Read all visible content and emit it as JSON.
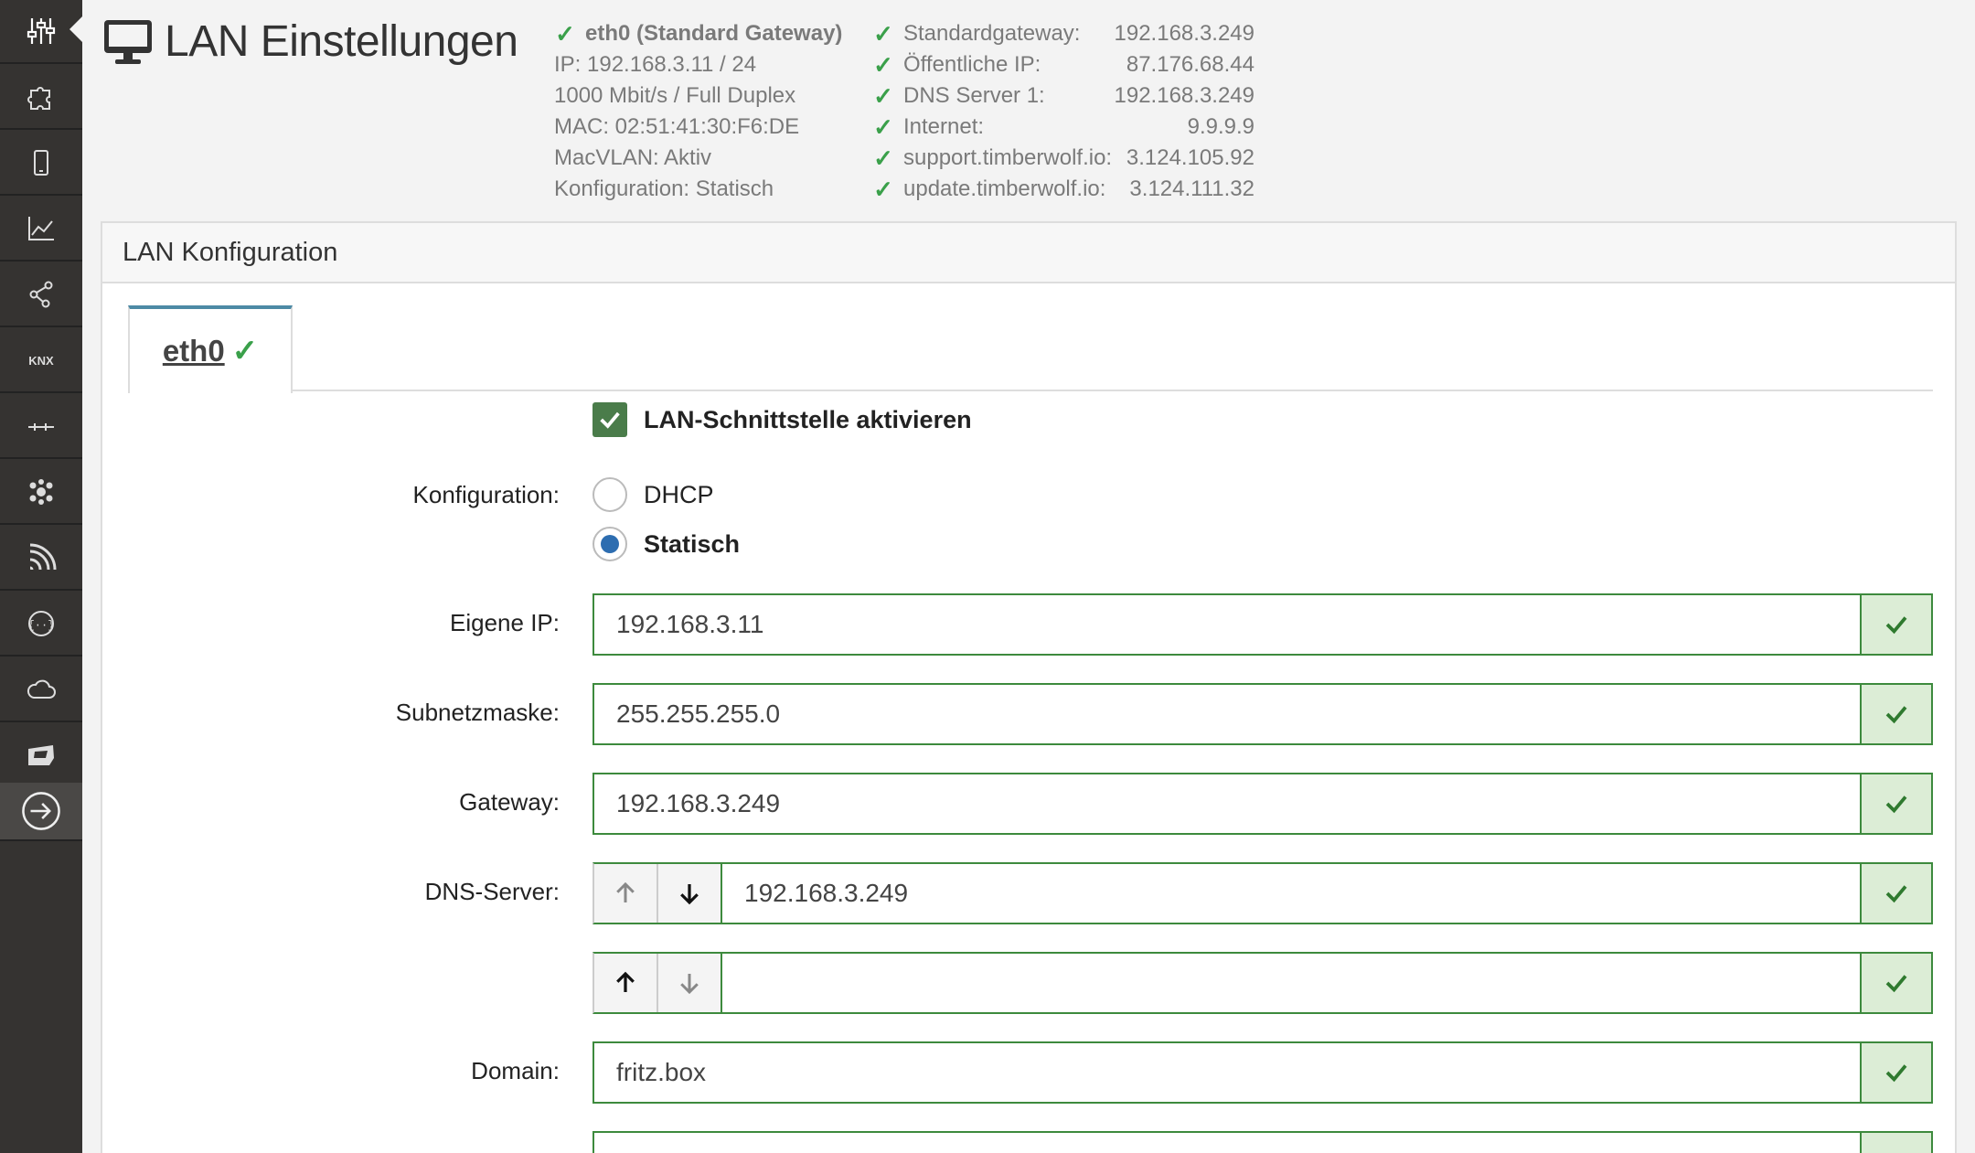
{
  "header": {
    "title": "LAN Einstellungen"
  },
  "status_left": {
    "interface": "eth0 (Standard Gateway)",
    "lines": [
      "IP: 192.168.3.11 / 24",
      "1000 Mbit/s / Full Duplex",
      "MAC: 02:51:41:30:F6:DE",
      "MacVLAN: Aktiv",
      "Konfiguration: Statisch"
    ]
  },
  "status_right": [
    {
      "label": "Standardgateway:",
      "value": "192.168.3.249"
    },
    {
      "label": "Öffentliche IP:",
      "value": "87.176.68.44"
    },
    {
      "label": "DNS Server 1:",
      "value": "192.168.3.249"
    },
    {
      "label": "Internet:",
      "value": "9.9.9.9"
    },
    {
      "label": "support.timberwolf.io:",
      "value": "3.124.105.92"
    },
    {
      "label": "update.timberwolf.io:",
      "value": "3.124.111.32"
    }
  ],
  "panel": {
    "title": "LAN Konfiguration",
    "tab": "eth0"
  },
  "form": {
    "enable_label": "LAN-Schnittstelle aktivieren",
    "konfiguration_label": "Konfiguration:",
    "option_dhcp": "DHCP",
    "option_static": "Statisch",
    "ip_label": "Eigene IP:",
    "ip_value": "192.168.3.11",
    "subnet_label": "Subnetzmaske:",
    "subnet_value": "255.255.255.0",
    "gateway_label": "Gateway:",
    "gateway_value": "192.168.3.249",
    "dns_label": "DNS-Server:",
    "dns1_value": "192.168.3.249",
    "dns2_value": "",
    "domain_label": "Domain:",
    "domain_value": "fritz.box"
  },
  "colors": {
    "sidebar": "#353331",
    "success": "#3aa04a",
    "field_border": "#3d8a3d",
    "tab_accent": "#4d8aa5",
    "radio_selected": "#2d6db0"
  },
  "sidebar_icons": [
    "sliders-icon",
    "puzzle-icon",
    "mobile-icon",
    "chart-icon",
    "share-icon",
    "knx-icon",
    "bus-icon",
    "cluster-icon",
    "rss-icon",
    "api-icon",
    "cloud-icon",
    "flag-icon",
    "logout-icon"
  ]
}
